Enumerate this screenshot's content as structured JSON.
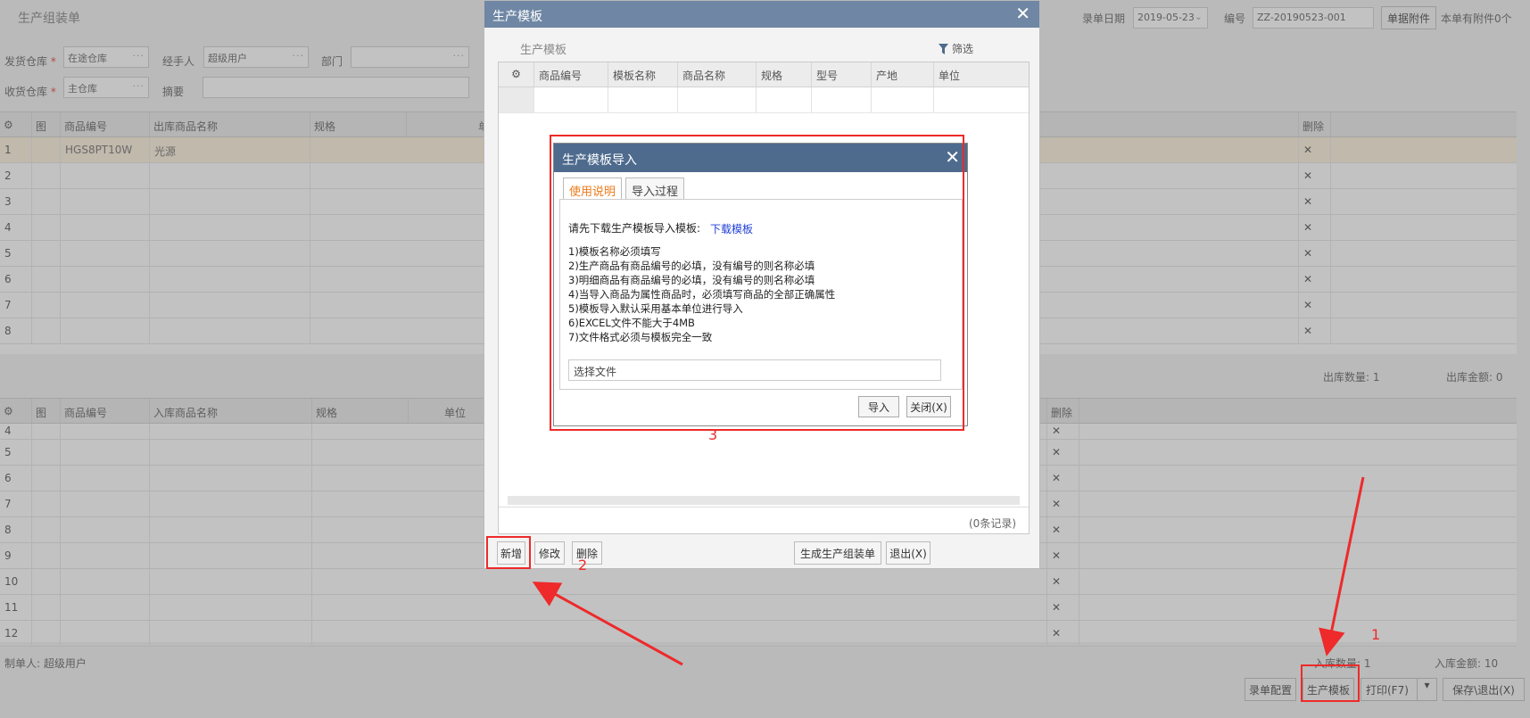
{
  "page": {
    "title": "生产组装单",
    "entry_date_label": "录单日期",
    "entry_date_value": "2019-05-23",
    "number_label": "编号",
    "number_value": "ZZ-20190523-001",
    "attachment_button": "单据附件",
    "attachment_info": "本单有附件0个"
  },
  "form": {
    "ship_warehouse_label": "发货仓库",
    "ship_warehouse_value": "在途仓库",
    "handler_label": "经手人",
    "handler_value": "超级用户",
    "department_label": "部门",
    "receive_warehouse_label": "收货仓库",
    "receive_warehouse_value": "主仓库",
    "summary_label": "摘要",
    "required_mark": "*"
  },
  "out_grid": {
    "headers": [
      "图",
      "商品编号",
      "出库商品名称",
      "规格",
      "单位",
      "删除"
    ],
    "rows": [
      {
        "num": "1",
        "code": "HGS8PT10W",
        "name": "光源"
      },
      {
        "num": "2"
      },
      {
        "num": "3"
      },
      {
        "num": "4"
      },
      {
        "num": "5"
      },
      {
        "num": "6"
      },
      {
        "num": "7"
      },
      {
        "num": "8"
      }
    ],
    "delete_glyph": "✕",
    "qty_label": "出库数量:",
    "qty_value": "1",
    "amount_label": "出库金额:",
    "amount_value": "0"
  },
  "in_grid": {
    "headers": [
      "图",
      "商品编号",
      "入库商品名称",
      "规格",
      "单位",
      "删除"
    ],
    "rows": [
      {
        "num": "4"
      },
      {
        "num": "5"
      },
      {
        "num": "6"
      },
      {
        "num": "7"
      },
      {
        "num": "8"
      },
      {
        "num": "9"
      },
      {
        "num": "10"
      },
      {
        "num": "11"
      },
      {
        "num": "12"
      }
    ],
    "qty_label": "入库数量:",
    "qty_value": "1",
    "amount_label": "入库金额:",
    "amount_value": "10"
  },
  "footer": {
    "creator_label": "制单人:",
    "creator_value": "超级用户",
    "btn_config": "录单配置",
    "btn_template": "生产模板",
    "btn_print": "打印(F7)",
    "btn_save_exit": "保存\\退出(X)"
  },
  "template_dialog": {
    "title": "生产模板",
    "subtitle": "生产模板",
    "filter_label": "筛选",
    "headers": [
      "商品编号",
      "模板名称",
      "商品名称",
      "规格",
      "型号",
      "产地",
      "单位"
    ],
    "records": "(0条记录)",
    "btn_add": "新增",
    "btn_edit": "修改",
    "btn_delete": "删除",
    "btn_generate": "生成生产组装单",
    "btn_exit": "退出(X)"
  },
  "import_modal": {
    "title": "生产模板导入",
    "tab_instructions": "使用说明",
    "tab_process": "导入过程",
    "download_prompt": "请先下载生产模板导入模板:",
    "download_link": "下载模板",
    "rules": [
      "1)模板名称必须填写",
      "2)生产商品有商品编号的必填，没有编号的则名称必填",
      "3)明细商品有商品编号的必填，没有编号的则名称必填",
      "4)当导入商品为属性商品时，必须填写商品的全部正确属性",
      "5)模板导入默认采用基本单位进行导入",
      "6)EXCEL文件不能大于4MB",
      "7)文件格式必须与模板完全一致"
    ],
    "file_placeholder": "选择文件",
    "btn_import": "导入",
    "btn_close": "关闭(X)"
  },
  "annotations": {
    "n1": "1",
    "n2": "2",
    "n3": "3"
  },
  "colors": {
    "annotation_red": "#ee2a2a",
    "modal_header": "#4e6b8e",
    "dialog_header": "#6f87a4",
    "active_tab": "#ee7a1a",
    "link": "#1f3fd8",
    "delete_red": "#e0403a"
  }
}
